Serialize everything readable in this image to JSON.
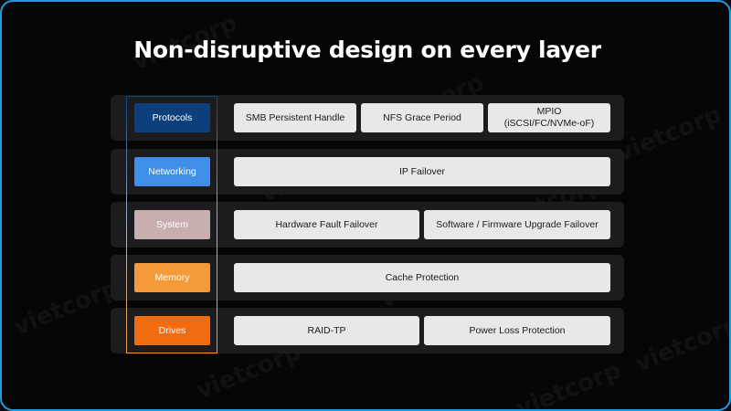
{
  "title": "Non-disruptive design on every layer",
  "watermark_text": "vietcorp",
  "colors": {
    "frame_border": "#1e9be0",
    "outline": "#1e9be0",
    "protocols": "#0d3f7d",
    "networking": "#3f8fe8",
    "system": "#c9aeb0",
    "memory": "#f59a38",
    "drives": "#f26c0f"
  },
  "layers": [
    {
      "label": "Protocols",
      "items": [
        "SMB Persistent Handle",
        "NFS Grace Period",
        "MPIO\n(iSCSI/FC/NVMe-oF)"
      ]
    },
    {
      "label": "Networking",
      "items": [
        "IP Failover"
      ]
    },
    {
      "label": "System",
      "items": [
        "Hardware Fault Failover",
        "Software / Firmware Upgrade Failover"
      ]
    },
    {
      "label": "Memory",
      "items": [
        "Cache Protection"
      ]
    },
    {
      "label": "Drives",
      "items": [
        "RAID-TP",
        "Power Loss Protection"
      ]
    }
  ]
}
